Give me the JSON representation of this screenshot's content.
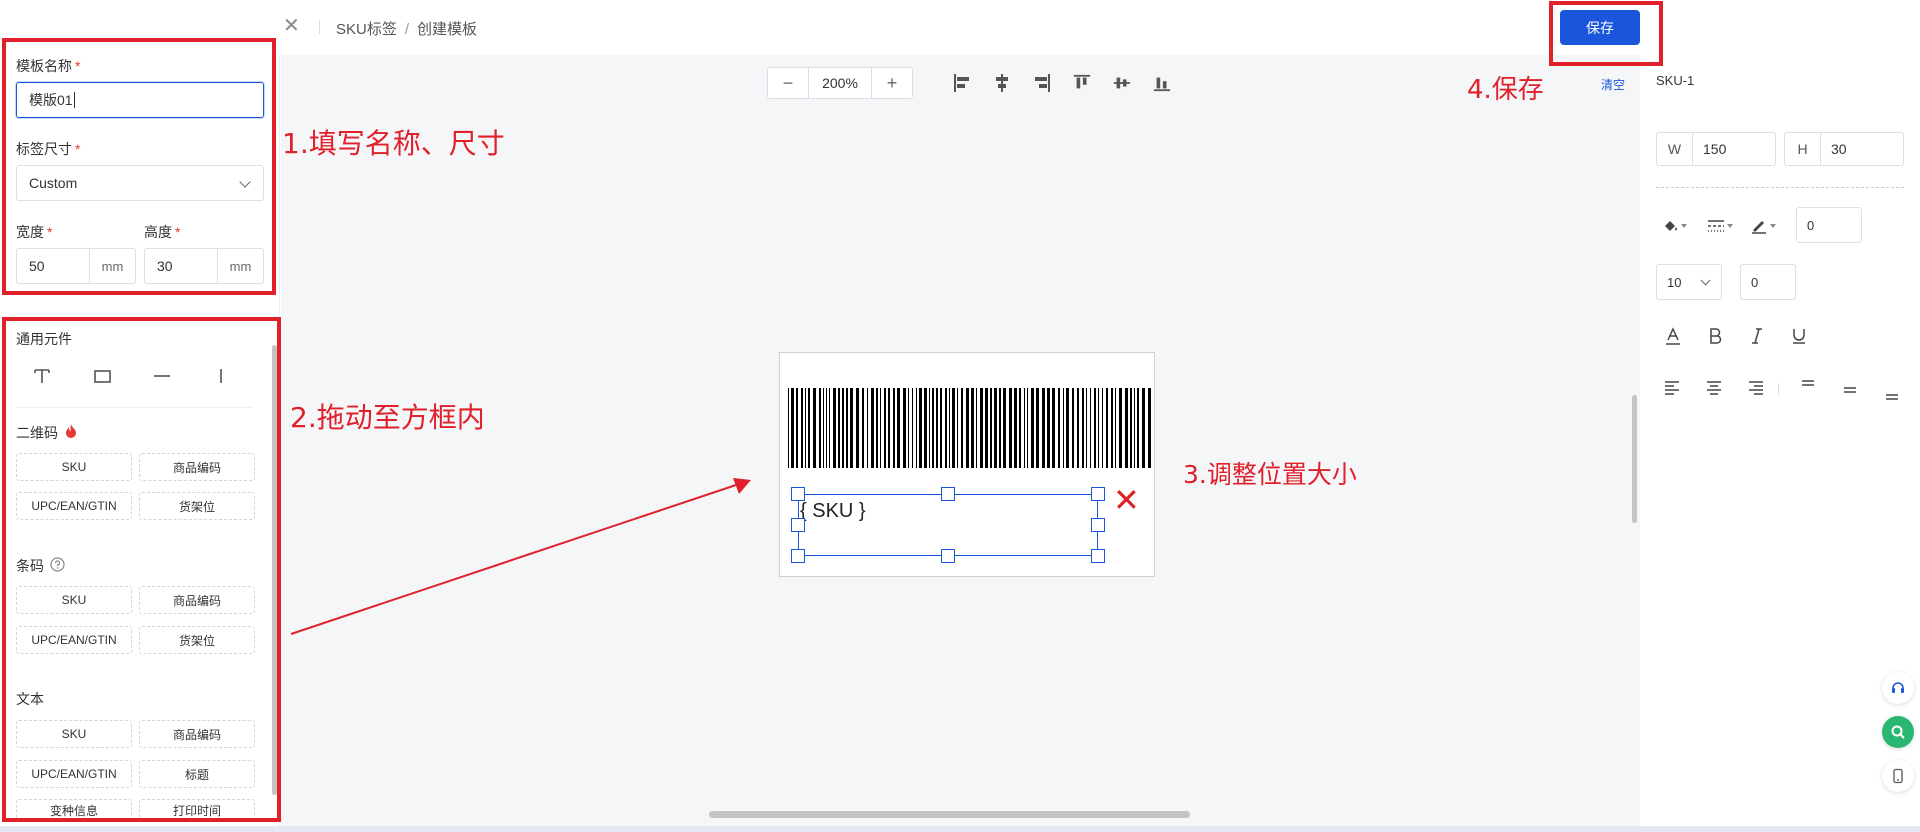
{
  "header": {
    "breadcrumb_root": "SKU标签",
    "breadcrumb_sep": "/",
    "breadcrumb_current": "创建模板",
    "save_label": "保存"
  },
  "form": {
    "name_label": "模板名称",
    "name_value": "模版01",
    "size_label": "标签尺寸",
    "size_value": "Custom",
    "width_label": "宽度",
    "width_value": "50",
    "width_unit": "mm",
    "height_label": "高度",
    "height_value": "30",
    "height_unit": "mm",
    "required_mark": "*"
  },
  "components": {
    "general_title": "通用元件",
    "qrcode_title": "二维码",
    "qrcode_items": [
      "SKU",
      "商品编码",
      "UPC/EAN/GTIN",
      "货架位"
    ],
    "barcode_title": "条码",
    "barcode_items": [
      "SKU",
      "商品编码",
      "UPC/EAN/GTIN",
      "货架位"
    ],
    "text_title": "文本",
    "text_items": [
      "SKU",
      "商品编码",
      "UPC/EAN/GTIN",
      "标题",
      "变种信息",
      "打印时间"
    ]
  },
  "toolbar": {
    "zoom_minus": "−",
    "zoom_value": "200%",
    "zoom_plus": "+",
    "clear_label": "清空"
  },
  "canvas": {
    "sku_placeholder": "{ SKU }",
    "delete_glyph": "✕"
  },
  "props": {
    "element_name": "SKU-1",
    "w_label": "W",
    "w_value": "150",
    "h_label": "H",
    "h_value": "30",
    "border_value": "0",
    "font_size": "10",
    "spacing_value": "0"
  },
  "annotations": {
    "step1": "1.填写名称、尺寸",
    "step2": "2.拖动至方框内",
    "step3": "3.调整位置大小",
    "step4": "4.保存"
  },
  "colors": {
    "accent": "#1a56db",
    "annotation": "#e0202a"
  }
}
